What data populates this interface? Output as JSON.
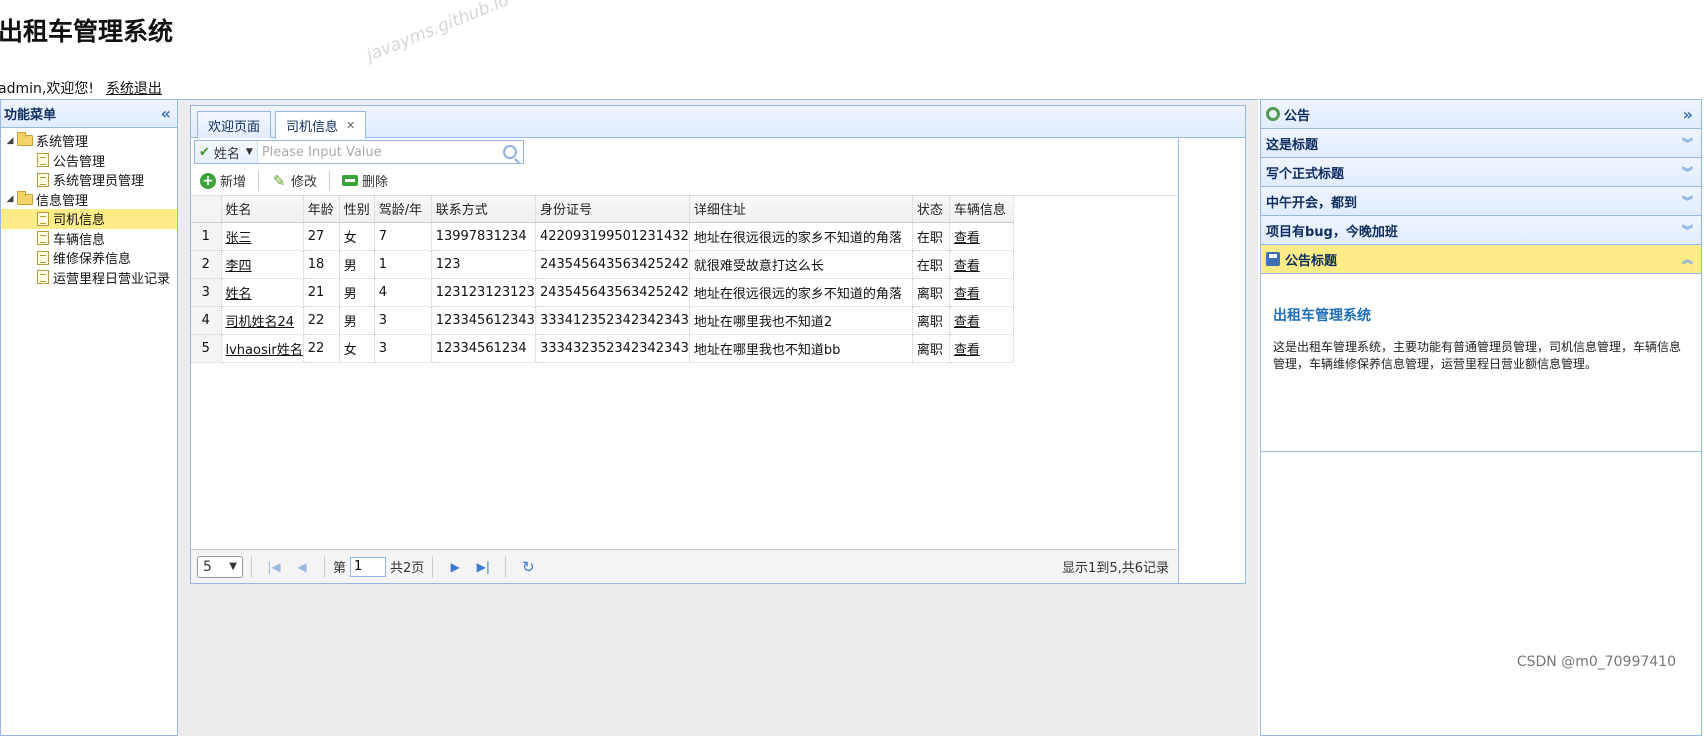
{
  "header": {
    "title": "出租车管理系统",
    "welcome": "admin,欢迎您!",
    "logout": "系统退出"
  },
  "watermark": "javayms.github.io",
  "credit": "CSDN @m0_70997410",
  "menu": {
    "title": "功能菜单",
    "groups": [
      {
        "label": "系统管理",
        "items": [
          "公告管理",
          "系统管理员管理"
        ]
      },
      {
        "label": "信息管理",
        "items": [
          "司机信息",
          "车辆信息",
          "维修保养信息",
          "运营里程日营业记录"
        ]
      }
    ],
    "selected": "司机信息"
  },
  "tabs": [
    {
      "label": "欢迎页面",
      "active": false
    },
    {
      "label": "司机信息",
      "active": true,
      "closable": true
    }
  ],
  "search": {
    "field": "姓名",
    "placeholder": "Please Input Value"
  },
  "toolbar": {
    "add": "新增",
    "edit": "修改",
    "delete": "删除"
  },
  "grid": {
    "columns": [
      "姓名",
      "年龄",
      "性别",
      "驾龄/年",
      "联系方式",
      "身份证号",
      "详细住址",
      "状态",
      "车辆信息"
    ],
    "rows": [
      {
        "n": "1",
        "name": "张三",
        "age": "27",
        "sex": "女",
        "years": "7",
        "phone": "13997831234",
        "id": "422093199501231432",
        "addr": "地址在很远很远的家乡不知道的角落",
        "status": "在职",
        "car": "查看"
      },
      {
        "n": "2",
        "name": "李四",
        "age": "18",
        "sex": "男",
        "years": "1",
        "phone": "123",
        "id": "243545643563425242",
        "addr": "就很难受故意打这么长",
        "status": "在职",
        "car": "查看"
      },
      {
        "n": "3",
        "name": "姓名",
        "age": "21",
        "sex": "男",
        "years": "4",
        "phone": "123123123123",
        "id": "243545643563425242",
        "addr": "地址在很远很远的家乡不知道的角落",
        "status": "离职",
        "car": "查看"
      },
      {
        "n": "4",
        "name": "司机姓名24",
        "age": "22",
        "sex": "男",
        "years": "3",
        "phone": "123345612343",
        "id": "333412352342342343",
        "addr": "地址在哪里我也不知道2",
        "status": "离职",
        "car": "查看"
      },
      {
        "n": "5",
        "name": "lvhaosir姓名",
        "age": "22",
        "sex": "女",
        "years": "3",
        "phone": "12334561234",
        "id": "333432352342342343",
        "addr": "地址在哪里我也不知道bb",
        "status": "离职",
        "car": "查看"
      }
    ]
  },
  "pager": {
    "page_size": "5",
    "page_prefix": "第",
    "page": "1",
    "page_total": "共2页",
    "info": "显示1到5,共6记录"
  },
  "notices": {
    "title": "公告",
    "items": [
      "这是标题",
      "写个正式标题",
      "中午开会，都到",
      "项目有bug，今晚加班",
      "公告标题"
    ],
    "open_index": 4,
    "body_title": "出租车管理系统",
    "body_text": "这是出租车管理系统，主要功能有普通管理员管理，司机信息管理，车辆信息管理，车辆维修保养信息管理，运营里程日营业额信息管理。"
  }
}
